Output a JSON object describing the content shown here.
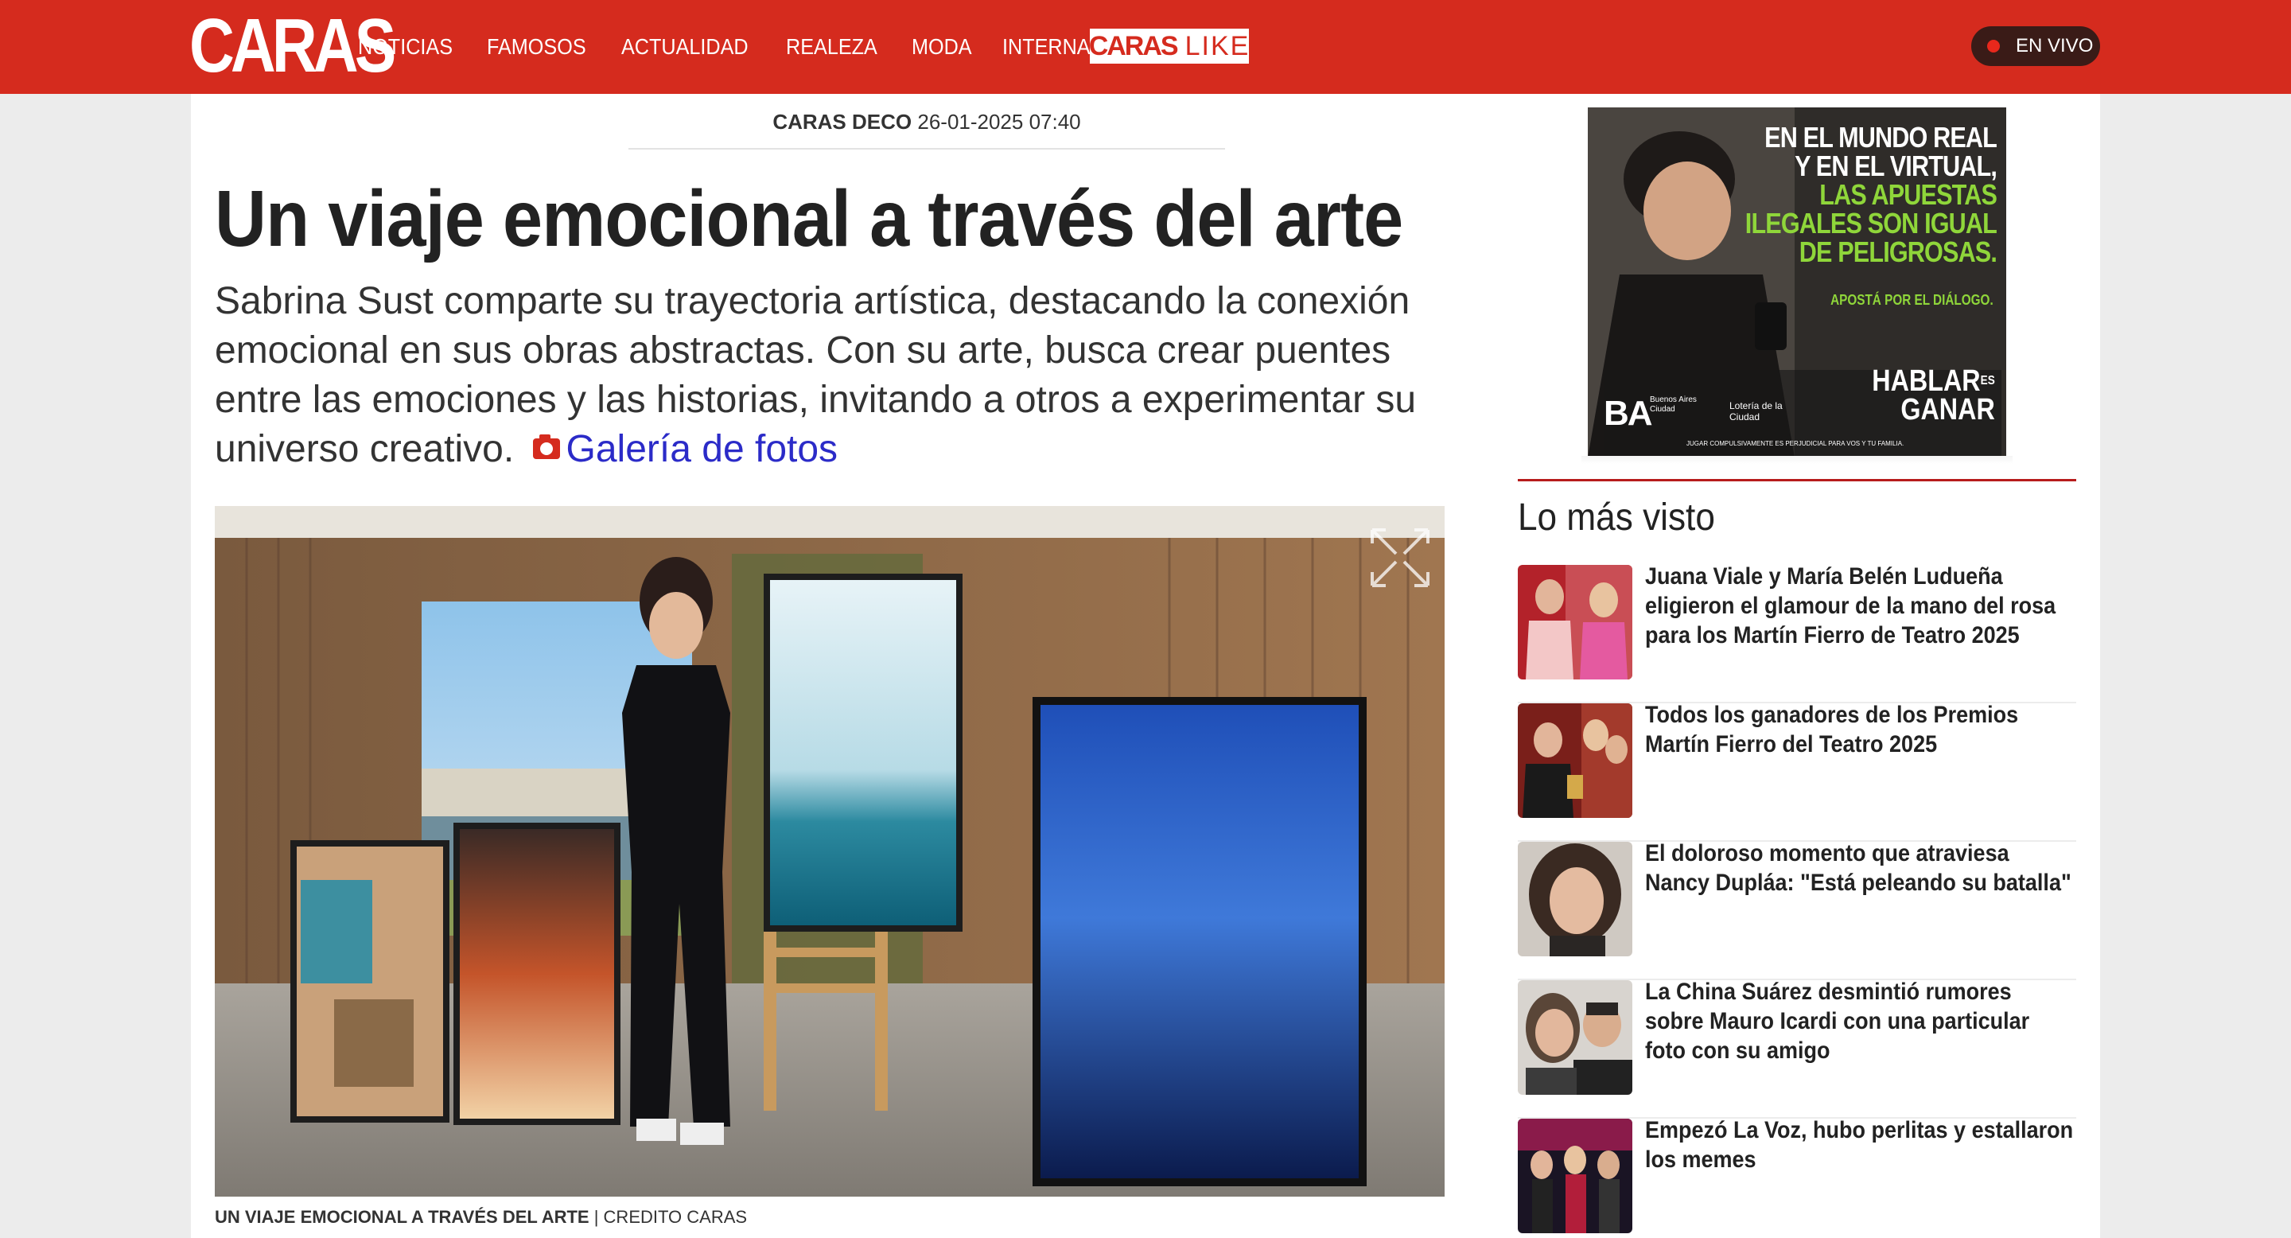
{
  "header": {
    "logo": "CARAS",
    "nav": [
      "NOTICIAS",
      "FAMOSOS",
      "ACTUALIDAD",
      "REALEZA",
      "MODA",
      "INTERNACIONAL"
    ],
    "caras_like": {
      "a": "CARAS",
      "b": "LIKE"
    },
    "live_label": "EN VIVO"
  },
  "article": {
    "section": "CARAS DECO",
    "datetime": "26-01-2025 07:40",
    "title": "Un viaje emocional a través del arte",
    "summary": "Sabrina Sust comparte su trayectoria artística, destacando la conexión emocional en sus obras abstractas. Con su arte, busca crear puentes entre las emociones y las historias, invitando a otros a experimentar su universo creativo.",
    "gallery_link": "Galería de fotos",
    "image_caption_title": "UN VIAJE EMOCIONAL A TRAVÉS DEL ARTE",
    "image_caption_credit": " | CREDITO CARAS"
  },
  "ad": {
    "line1": "EN EL MUNDO REAL",
    "line2": "Y EN EL VIRTUAL,",
    "line3": "LAS APUESTAS",
    "line4": "ILEGALES SON IGUAL",
    "line5": "DE PELIGROSAS.",
    "tagline": "APOSTÁ POR EL DIÁLOGO.",
    "brand1": "BA",
    "brand1_sub": "Buenos Aires Ciudad",
    "brand2": "Lotería de la Ciudad",
    "slogan1": "HABLAR",
    "slogan_es": "ES",
    "slogan2": "GANAR",
    "legal": "JUGAR COMPULSIVAMENTE ES PERJUDICIAL PARA VOS Y TU FAMILIA."
  },
  "most_viewed": {
    "title": "Lo más visto",
    "items": [
      {
        "text": "Juana Viale y María Belén Ludueña eligieron el glamour de la mano del rosa para los Martín Fierro de Teatro 2025"
      },
      {
        "text": "Todos los ganadores de los Premios Martín Fierro del Teatro 2025"
      },
      {
        "text": "El doloroso momento que atraviesa Nancy Dupláa: \"Está peleando su batalla\""
      },
      {
        "text": "La China Suárez desmintió rumores sobre Mauro Icardi con una particular foto con su amigo"
      },
      {
        "text": "Empezó La Voz, hubo perlitas y estallaron los memes"
      }
    ]
  },
  "colors": {
    "brand_red": "#d52b1e",
    "link_blue": "#2b2bc8",
    "ad_green": "#8fd63a"
  }
}
